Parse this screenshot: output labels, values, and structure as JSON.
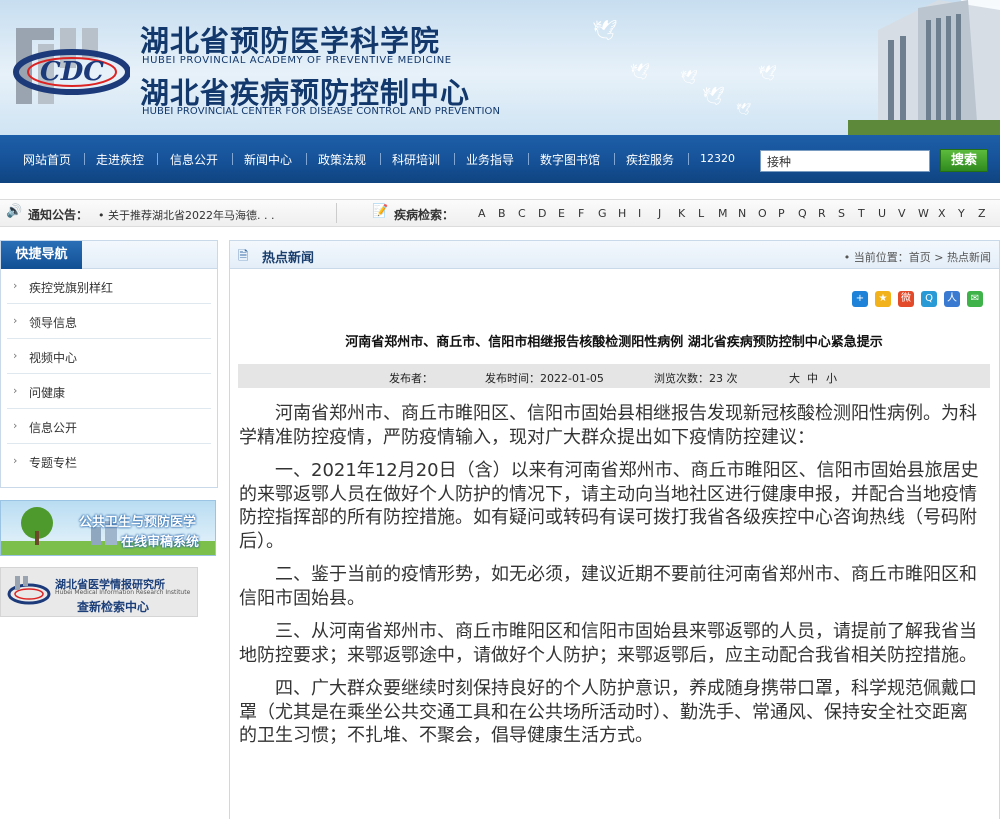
{
  "header": {
    "title_cn_1": "湖北省预防医学科学院",
    "title_en_1": "HUBEI PROVINCIAL ACADEMY OF PREVENTIVE MEDICINE",
    "title_cn_2": "湖北省疾病预防控制中心",
    "title_en_2": "HUBEI PROVINCIAL CENTER FOR DISEASE CONTROL AND PREVENTION",
    "logo_text": "CDC"
  },
  "nav": {
    "items": [
      "网站首页",
      "走进疾控",
      "信息公开",
      "新闻中心",
      "政策法规",
      "科研培训",
      "业务指导",
      "数字图书馆",
      "疾控服务",
      "12320"
    ],
    "search_value": "接种",
    "search_button": "搜索"
  },
  "notice": {
    "label": "通知公告：",
    "text": "• 关于推荐湖北省2022年马海德. . .",
    "disease_label": "疾病检索：",
    "letters": [
      "A",
      "B",
      "C",
      "D",
      "E",
      "F",
      "G",
      "H",
      "I",
      "J",
      "K",
      "L",
      "M",
      "N",
      "O",
      "P",
      "Q",
      "R",
      "S",
      "T",
      "U",
      "V",
      "W",
      "X",
      "Y",
      "Z"
    ]
  },
  "sidebar": {
    "title": "快捷导航",
    "items": [
      "疾控党旗别样红",
      "领导信息",
      "视频中心",
      "问健康",
      "信息公开",
      "专题专栏"
    ],
    "banner1_line1": "公共卫生与预防医学",
    "banner1_line2": "在线审稿系统",
    "banner2_name": "湖北省医学情报研究所",
    "banner2_en": "Hubei Medical Information Research Institute",
    "banner2_sub": "查新检索中心"
  },
  "main": {
    "section_title": "热点新闻",
    "breadcrumb": "• 当前位置：首页 > 热点新闻",
    "article_title": "河南省郑州市、商丘市、信阳市相继报告核酸检测阳性病例 湖北省疾病预防控制中心紧急提示",
    "meta": {
      "publisher": "发布者：",
      "time": "发布时间：2022-01-05",
      "views": "浏览次数：23 次",
      "size_large": "大",
      "size_mid": "中",
      "size_small": "小"
    },
    "paragraphs": [
      "河南省郑州市、商丘市睢阳区、信阳市固始县相继报告发现新冠核酸检测阳性病例。为科学精准防控疫情，严防疫情输入，现对广大群众提出如下疫情防控建议：",
      "一、2021年12月20日（含）以来有河南省郑州市、商丘市睢阳区、信阳市固始县旅居史的来鄂返鄂人员在做好个人防护的情况下，请主动向当地社区进行健康申报，并配合当地疫情防控指挥部的所有防控措施。如有疑问或转码有误可拨打我省各级疾控中心咨询热线（号码附后）。",
      "二、鉴于当前的疫情形势，如无必须，建议近期不要前往河南省郑州市、商丘市睢阳区和信阳市固始县。",
      "三、从河南省郑州市、商丘市睢阳区和信阳市固始县来鄂返鄂的人员，请提前了解我省当地防控要求；来鄂返鄂途中，请做好个人防护；来鄂返鄂后，应主动配合我省相关防控措施。",
      "四、广大群众要继续时刻保持良好的个人防护意识，养成随身携带口罩，科学规范佩戴口罩（尤其是在乘坐公共交通工具和在公共场所活动时）、勤洗手、常通风、保持安全社交距离的卫生习惯；不扎堆、不聚会，倡导健康生活方式。"
    ]
  },
  "colors": {
    "nav_blue": "#155096",
    "title_navy": "#12386c",
    "search_green": "#2f8a1e"
  }
}
